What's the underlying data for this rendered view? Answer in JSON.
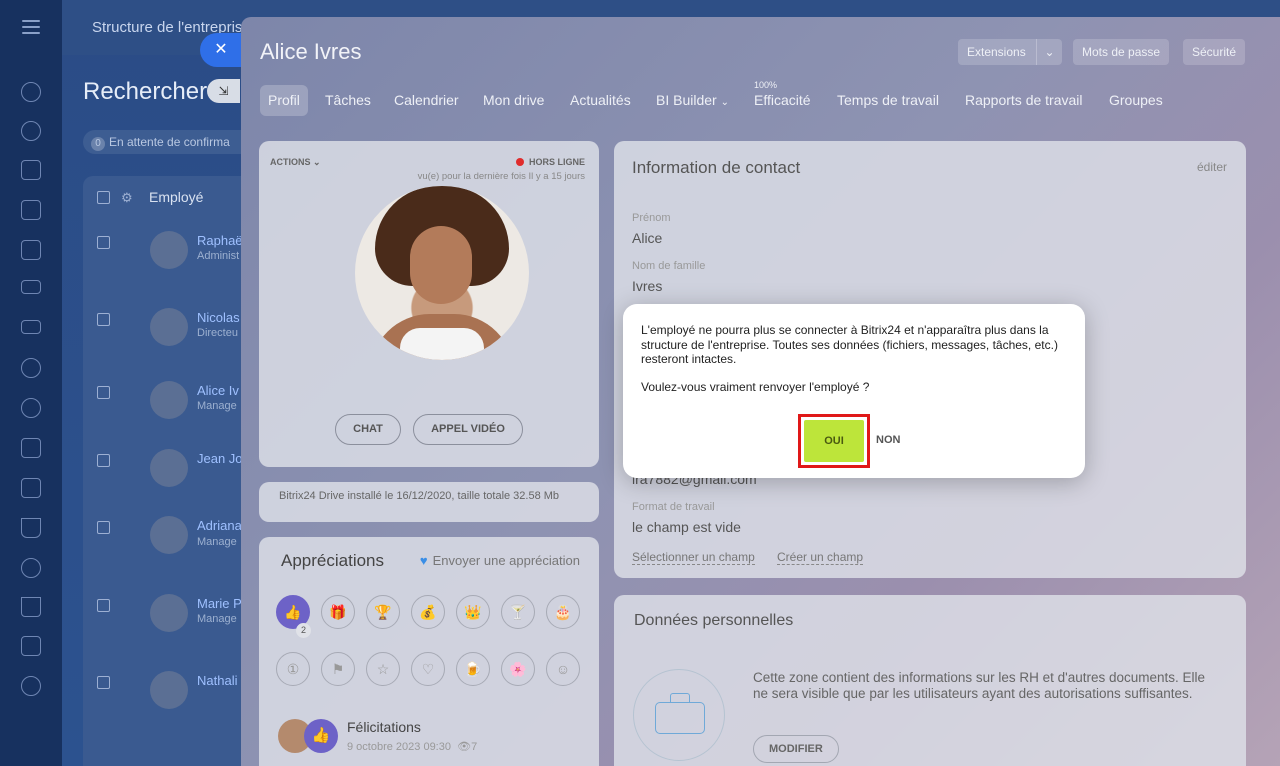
{
  "left_rail": {
    "icons": [
      "menu-icon",
      "activity-icon",
      "chat-icon",
      "feed-icon",
      "calendar-icon",
      "document-icon",
      "drive-icon",
      "mail-icon",
      "groups-icon",
      "shield-icon",
      "presentation-icon",
      "checklist-icon",
      "filter-icon",
      "box-icon",
      "cart-icon",
      "id-card-icon",
      "users-icon"
    ]
  },
  "background": {
    "top_title": "Structure de l'entreprise",
    "search_title": "Rechercher",
    "pending_count": "0",
    "pending_label": "En attente de confirma",
    "table_header": "Employé",
    "rows": [
      {
        "name": "Raphaë",
        "sub": "Administ"
      },
      {
        "name": "Nicolas",
        "sub": "Directeu"
      },
      {
        "name": "Alice Iv",
        "sub": "Manage"
      },
      {
        "name": "Jean Jo",
        "sub": ""
      },
      {
        "name": "Adriana",
        "sub": "Manage"
      },
      {
        "name": "Marie P",
        "sub": "Manage"
      },
      {
        "name": "Nathali",
        "sub": ""
      }
    ]
  },
  "slider": {
    "title": "Alice Ivres",
    "header_buttons": [
      "Extensions",
      "Mots de passe",
      "Sécurité"
    ],
    "tabs": [
      "Profil",
      "Tâches",
      "Calendrier",
      "Mon drive",
      "Actualités",
      "BI Builder",
      "Efficacité",
      "Temps de travail",
      "Rapports de travail",
      "Groupes"
    ],
    "efficiency_badge": "100%",
    "profile": {
      "actions_label": "ACTIONS",
      "status": "HORS LIGNE",
      "last_seen": "vu(e) pour la dernière fois Il y a 15 jours",
      "chat_button": "CHAT",
      "video_button": "APPEL VIDÉO"
    },
    "drive_info": "Bitrix24 Drive installé le 16/12/2020, taille totale 32.58 Mb",
    "appreciations": {
      "title": "Appréciations",
      "send_link": "Envoyer une appréciation",
      "badges_row1": [
        "👍",
        "🎁",
        "🏆",
        "💰",
        "👑",
        "🍸",
        "🎂"
      ],
      "badges_row2": [
        "①",
        "⚑",
        "☆",
        "♡",
        "🍺",
        "🌸",
        "☺"
      ],
      "first_badge_count": "2",
      "kudo_title": "Félicitations",
      "kudo_date": "9 octobre 2023 09:30",
      "kudo_views": "7"
    },
    "contact": {
      "title": "Information de contact",
      "edit_link": "éditer",
      "first_name_label": "Prénom",
      "first_name_value": "Alice",
      "last_name_label": "Nom de famille",
      "last_name_value": "Ivres",
      "email_partial": "lra7882@gmail.com",
      "work_format_label": "Format de travail",
      "work_format_value": "le champ est vide",
      "select_field_link": "Sélectionner un champ",
      "create_field_link": "Créer un champ"
    },
    "personal": {
      "title": "Données personnelles",
      "text": "Cette zone contient des informations sur les RH et d'autres documents. Elle ne sera visible que par les utilisateurs ayant des autorisations suffisantes.",
      "modify_button": "MODIFIER"
    }
  },
  "dialog": {
    "message": "L'employé ne pourra plus se connecter à Bitrix24 et n'apparaîtra plus dans la structure de l'entreprise. Toutes ses données (fichiers, messages, tâches, etc.) resteront intactes.",
    "question": "Voulez-vous vraiment renvoyer l'employé ?",
    "yes_label": "OUI",
    "no_label": "NON",
    "yes_color": "#bde53a",
    "highlight_color": "#e01818"
  },
  "colors": {
    "rail": "#17315f",
    "close_button": "#2f6fe8",
    "badge_active": "#6d62c7",
    "offline_dot": "#e02c2c"
  }
}
